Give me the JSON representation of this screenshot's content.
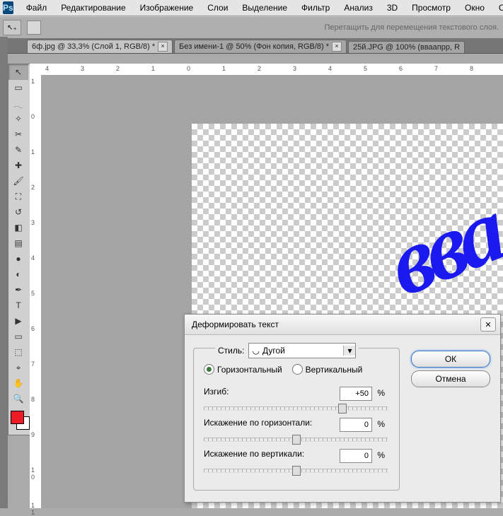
{
  "app": {
    "logo": "Ps"
  },
  "menu": [
    "Файл",
    "Редактирование",
    "Изображение",
    "Слои",
    "Выделение",
    "Фильтр",
    "Анализ",
    "3D",
    "Просмотр",
    "Окно",
    "Спра"
  ],
  "options": {
    "hint": "Перетащить для перемещения текстового слоя."
  },
  "tabs": [
    {
      "label": "6ф.jpg @ 33,3% (Слой 1, RGB/8) *",
      "closable": true,
      "active": true
    },
    {
      "label": "Без имени-1 @ 50% (Фон копия, RGB/8) *",
      "closable": true,
      "active": false
    },
    {
      "label": "25й.JPG @ 100% (вваапрр, R",
      "closable": false,
      "active": false
    }
  ],
  "ruler_h": [
    "4",
    "3",
    "2",
    "1",
    "0",
    "1",
    "2",
    "3",
    "4",
    "5",
    "6",
    "7",
    "8"
  ],
  "ruler_v": [
    "1",
    "0",
    "1",
    "2",
    "3",
    "4",
    "5",
    "6",
    "7",
    "8",
    "9",
    "1\n0",
    "1\n1"
  ],
  "canvas_text": "вва",
  "dialog": {
    "title": "Деформировать текст",
    "style_label": "Стиль:",
    "style_value": "Дугой",
    "orient_h": "Горизонтальный",
    "orient_v": "Вертикальный",
    "orientation": "horizontal",
    "bend_label": "Изгиб:",
    "bend_value": "+50",
    "hdist_label": "Искажение по горизонтали:",
    "hdist_value": "0",
    "vdist_label": "Искажение по вертикали:",
    "vdist_value": "0",
    "pct": "%",
    "ok": "ОК",
    "cancel": "Отмена"
  },
  "colors": {
    "fg": "#ec1c24",
    "bg": "#ffffff"
  },
  "tools": [
    {
      "name": "move-tool",
      "glyph": "↖",
      "selected": true
    },
    {
      "name": "marquee-tool",
      "glyph": "▭"
    },
    {
      "name": "lasso-tool",
      "glyph": "𓂃"
    },
    {
      "name": "wand-tool",
      "glyph": "✧"
    },
    {
      "name": "crop-tool",
      "glyph": "✂"
    },
    {
      "name": "eyedropper-tool",
      "glyph": "✎"
    },
    {
      "name": "healing-tool",
      "glyph": "✚"
    },
    {
      "name": "brush-tool",
      "glyph": "🖌"
    },
    {
      "name": "stamp-tool",
      "glyph": "⛶"
    },
    {
      "name": "history-brush-tool",
      "glyph": "↺"
    },
    {
      "name": "eraser-tool",
      "glyph": "◧"
    },
    {
      "name": "gradient-tool",
      "glyph": "▤"
    },
    {
      "name": "blur-tool",
      "glyph": "●"
    },
    {
      "name": "dodge-tool",
      "glyph": "◐"
    },
    {
      "name": "pen-tool",
      "glyph": "✒"
    },
    {
      "name": "type-tool",
      "glyph": "T"
    },
    {
      "name": "path-select-tool",
      "glyph": "▶"
    },
    {
      "name": "shape-tool",
      "glyph": "▭"
    },
    {
      "name": "3d-tool",
      "glyph": "⬚"
    },
    {
      "name": "camera-tool",
      "glyph": "⌖"
    },
    {
      "name": "hand-tool",
      "glyph": "✋"
    },
    {
      "name": "zoom-tool",
      "glyph": "🔍"
    }
  ]
}
